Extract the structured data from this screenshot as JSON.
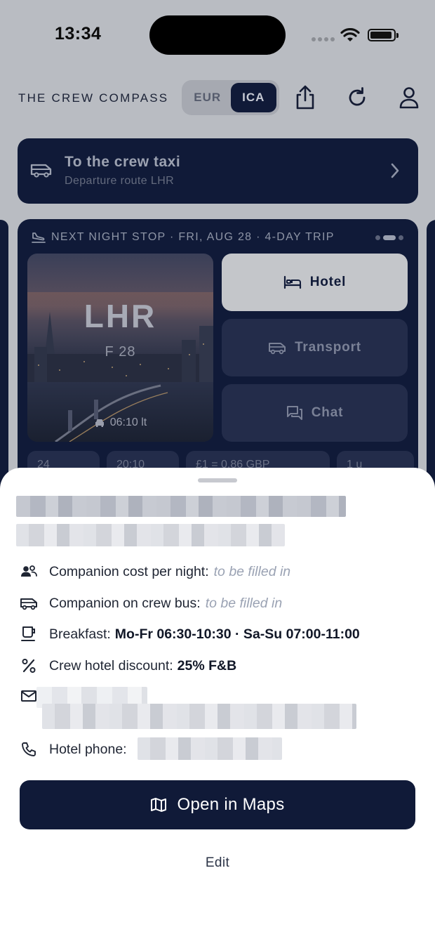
{
  "status_bar": {
    "time": "13:34"
  },
  "header": {
    "brand": "THE CREW COMPASS",
    "toggle": {
      "options": [
        "EUR",
        "ICA"
      ],
      "selected": "ICA"
    },
    "icons": [
      "share-icon",
      "refresh-icon",
      "profile-icon"
    ]
  },
  "taxi_banner": {
    "title": "To the crew taxi",
    "subtitle": "Departure route LHR"
  },
  "card": {
    "header": "NEXT NIGHT STOP · FRI, AUG 28 · 4-DAY TRIP",
    "pager": {
      "count": 3,
      "active": 2
    },
    "destination": {
      "code": "LHR",
      "gate": "F 28",
      "pickup_time": "06:10 lt"
    },
    "tiles": [
      {
        "label": "Hotel",
        "icon": "bed-icon",
        "active": true
      },
      {
        "label": "Transport",
        "icon": "bus-icon",
        "active": false
      },
      {
        "label": "Chat",
        "icon": "chat-icon",
        "active": false
      }
    ],
    "chips": [
      "24",
      "20:10",
      "£1 = 0.86 GBP",
      "1 u"
    ]
  },
  "sheet": {
    "rows": {
      "companion_cost": {
        "label": "Companion cost per night:",
        "value": "to be filled in"
      },
      "companion_bus": {
        "label": "Companion on crew bus:",
        "value": "to be filled in"
      },
      "breakfast": {
        "label": "Breakfast:",
        "value": "Mo-Fr 06:30-10:30 · Sa-Su 07:00-11:00"
      },
      "discount": {
        "label": "Crew hotel discount:",
        "value": "25% F&B"
      },
      "phone": {
        "label": "Hotel phone:"
      }
    },
    "maps_button": "Open in Maps",
    "edit_label": "Edit"
  },
  "colors": {
    "navy": "#101a38",
    "sheet_bg": "#ffffff",
    "placeholder": "#9aa2b3"
  }
}
